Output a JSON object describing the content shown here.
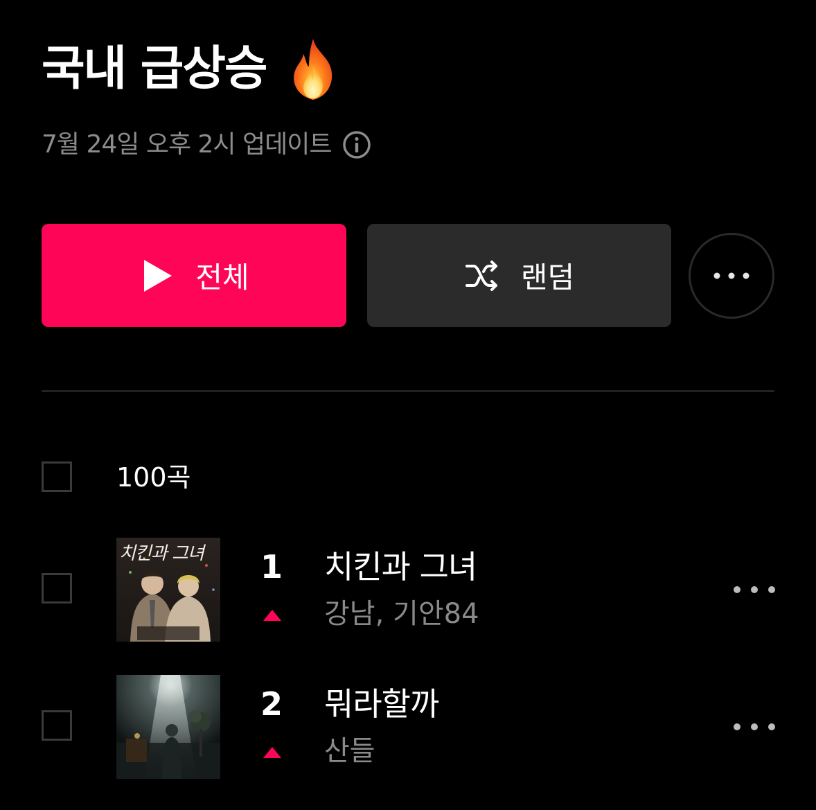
{
  "header": {
    "title": "국내 급상승",
    "title_icon": "fire-emoji",
    "updated_text": "7월 24일 오후 2시 업데이트",
    "info_icon": "info-circle-icon"
  },
  "actions": {
    "play_all_label": "전체",
    "shuffle_label": "랜덤",
    "more_icon": "ellipsis-icon",
    "play_color": "#ff0558",
    "shuffle_color": "#2b2b2b"
  },
  "list": {
    "count_label": "100곡",
    "trend_color": "#ff0558",
    "tracks": [
      {
        "rank": "1",
        "title": "치킨과 그녀",
        "artist": "강남, 기안84",
        "trend": "up",
        "art_text": "치킨과 그녀"
      },
      {
        "rank": "2",
        "title": "뭐라할까",
        "artist": "산들",
        "trend": "up"
      }
    ]
  }
}
